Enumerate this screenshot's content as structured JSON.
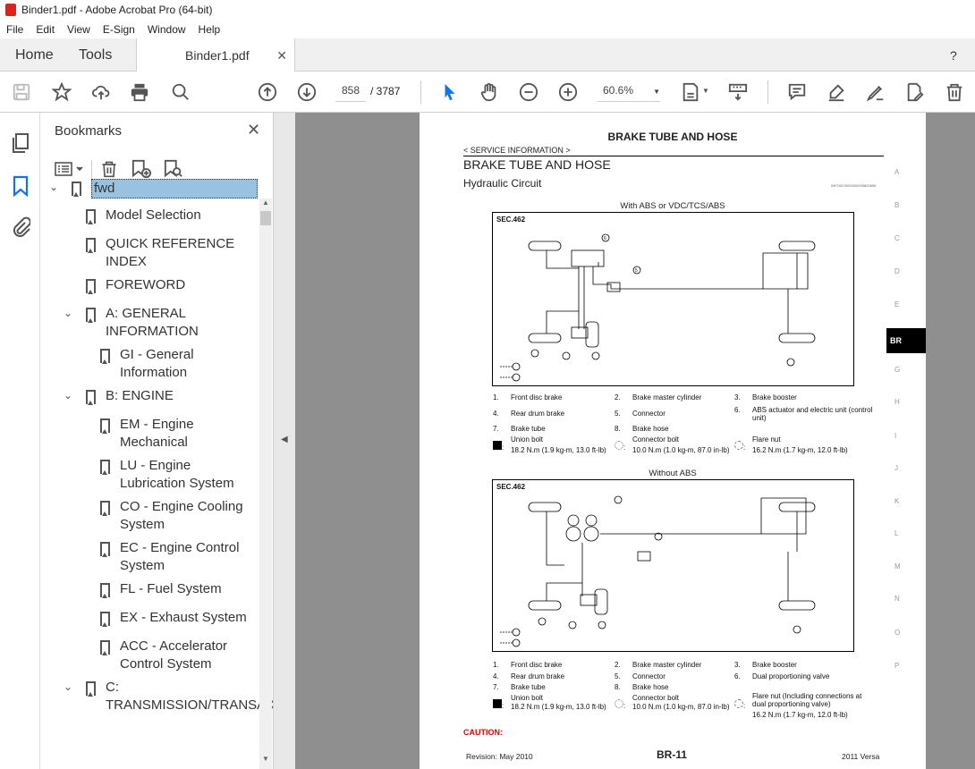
{
  "window": {
    "title": "Binder1.pdf - Adobe Acrobat Pro (64-bit)"
  },
  "menu": [
    "File",
    "Edit",
    "View",
    "E-Sign",
    "Window",
    "Help"
  ],
  "tabs": {
    "home": "Home",
    "tools": "Tools",
    "document": "Binder1.pdf"
  },
  "toolbar": {
    "page_current": "858",
    "page_total": "/ 3787",
    "zoom": "60.6%"
  },
  "bookmarks": {
    "title": "Bookmarks",
    "items": [
      {
        "label": "fwd",
        "level": 0,
        "expanded": true,
        "selected": true
      },
      {
        "label": "Model Selection",
        "level": 1
      },
      {
        "label": "QUICK REFERENCE INDEX",
        "level": 1
      },
      {
        "label": "FOREWORD",
        "level": 1
      },
      {
        "label": "A: GENERAL INFORMATION",
        "level": 1,
        "expanded": true
      },
      {
        "label": "GI - General Information",
        "level": 2
      },
      {
        "label": "B: ENGINE",
        "level": 1,
        "expanded": true
      },
      {
        "label": "EM - Engine Mechanical",
        "level": 2
      },
      {
        "label": "LU - Engine Lubrication System",
        "level": 2
      },
      {
        "label": "CO - Engine Cooling System",
        "level": 2
      },
      {
        "label": "EC - Engine Control System",
        "level": 2
      },
      {
        "label": "FL - Fuel System",
        "level": 2
      },
      {
        "label": "EX - Exhaust System",
        "level": 2
      },
      {
        "label": "ACC - Accelerator Control System",
        "level": 2
      },
      {
        "label": "C: TRANSMISSION/TRANSAXLE",
        "level": 1,
        "expanded": true
      }
    ]
  },
  "page": {
    "header": "BRAKE TUBE AND HOSE",
    "section": "< SERVICE INFORMATION >",
    "title": "BRAKE TUBE AND HOSE",
    "subtitle": "Hydraulic Circuit",
    "info_id": "INFOID:0000000005820896",
    "index_letters": [
      "A",
      "B",
      "C",
      "D",
      "E",
      "BR",
      "G",
      "H",
      "I",
      "J",
      "K",
      "L",
      "M",
      "N",
      "O",
      "P"
    ],
    "active_index": "BR",
    "diagram1": {
      "caption": "With ABS or VDC/TCS/ABS",
      "sec": "SEC.462",
      "legend": [
        "1.",
        "Front disc brake",
        "2.",
        "Brake master cylinder",
        "3.",
        "Brake booster",
        "4.",
        "Rear drum brake",
        "5.",
        "Connector",
        "6.",
        "ABS actuator and electric unit (control unit)",
        "7.",
        "Brake tube",
        "8.",
        "Brake hose"
      ],
      "torques": [
        {
          "name": "Union bolt",
          "value": "18.2 N.m (1.9 kg-m, 13.0 ft-lb)"
        },
        {
          "name": "Connector bolt",
          "value": "10.0 N.m (1.0 kg-m, 87.0 in-lb)"
        },
        {
          "name": "Flare nut",
          "value": "16.2 N.m (1.7 kg-m, 12.0 ft-lb)"
        }
      ]
    },
    "diagram2": {
      "caption": "Without ABS",
      "sec": "SEC.462",
      "legend": [
        "1.",
        "Front disc brake",
        "2.",
        "Brake master cylinder",
        "3.",
        "Brake booster",
        "4.",
        "Rear drum brake",
        "5.",
        "Connector",
        "6.",
        "Dual proportioning valve",
        "7.",
        "Brake tube",
        "8.",
        "Brake hose"
      ],
      "torques": [
        {
          "name": "Union bolt",
          "value": "18.2 N.m (1.9 kg-m, 13.0 ft-lb)"
        },
        {
          "name": "Connector bolt",
          "value": "10.0 N.m (1.0 kg-m, 87.0 in-lb)"
        },
        {
          "name": "Flare nut (Including connections at dual proportioning valve)",
          "value": "16.2 N.m (1.7 kg-m, 12.0 ft-lb)"
        }
      ]
    },
    "caution": "CAUTION:",
    "footer_left": "Revision: May 2010",
    "footer_center": "BR-11",
    "footer_right": "2011 Versa"
  }
}
